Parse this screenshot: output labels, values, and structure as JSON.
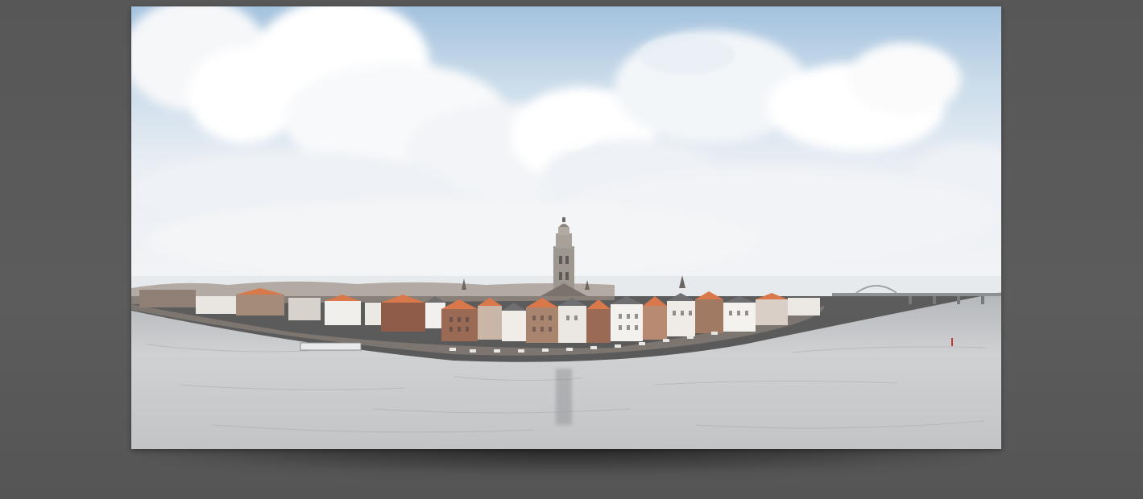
{
  "page": {
    "background_color": "#5a5a5a"
  },
  "photo": {
    "subject": "panorama-city-riverfront",
    "icon": "landscape-photo-icon",
    "colors": {
      "sky_top": "#a9c6e0",
      "sky_haze": "#eef1f5",
      "cloud": "#ffffff",
      "roof": "#d9784a",
      "brick": "#9a6a55",
      "water": "#c7c9cb",
      "water_dark": "#8f9294"
    }
  }
}
